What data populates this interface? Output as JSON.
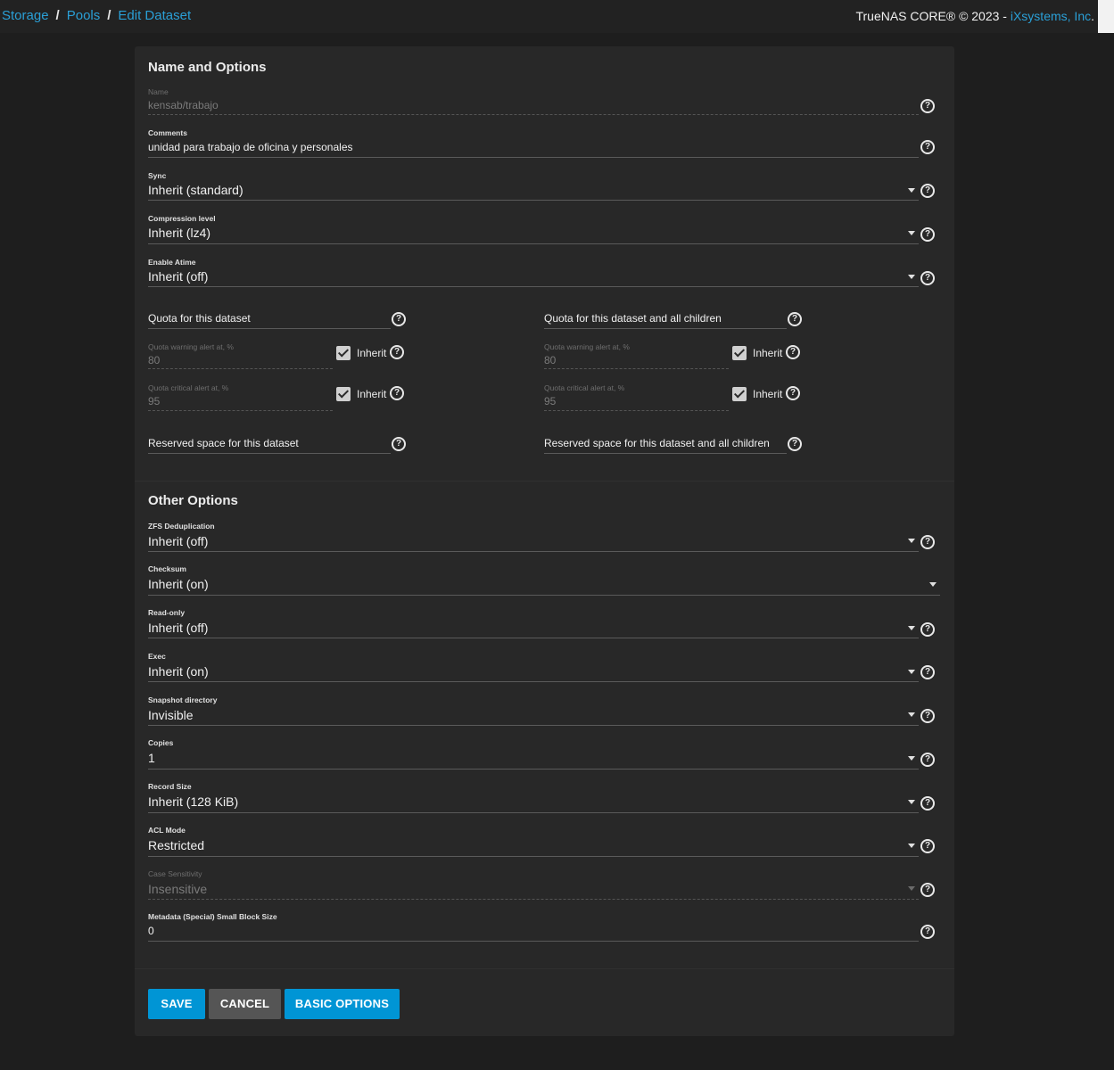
{
  "header": {
    "breadcrumb": [
      "Storage",
      "Pools",
      "Edit Dataset"
    ],
    "separator": "/",
    "copyright_prefix": "TrueNAS CORE® © 2023 - ",
    "copyright_link": "iXsystems, Inc",
    "copyright_suffix": "."
  },
  "sections": {
    "name_options": "Name and Options",
    "other_options": "Other Options"
  },
  "fields": {
    "name": {
      "label": "Name",
      "value": "kensab/trabajo"
    },
    "comments": {
      "label": "Comments",
      "value": "unidad para trabajo de oficina y personales"
    },
    "sync": {
      "label": "Sync",
      "value": "Inherit (standard)"
    },
    "compression": {
      "label": "Compression level",
      "value": "Inherit (lz4)"
    },
    "atime": {
      "label": "Enable Atime",
      "value": "Inherit (off)"
    }
  },
  "quota": {
    "dataset": {
      "label": "Quota for this dataset",
      "warning": {
        "label": "Quota warning alert at, %",
        "value": "80",
        "inherit_label": "Inherit"
      },
      "critical": {
        "label": "Quota critical alert at, %",
        "value": "95",
        "inherit_label": "Inherit"
      }
    },
    "children": {
      "label": "Quota for this dataset and all children",
      "warning": {
        "label": "Quota warning alert at, %",
        "value": "80",
        "inherit_label": "Inherit"
      },
      "critical": {
        "label": "Quota critical alert at, %",
        "value": "95",
        "inherit_label": "Inherit"
      }
    },
    "reserved_dataset": "Reserved space for this dataset",
    "reserved_children": "Reserved space for this dataset and all children"
  },
  "other": {
    "dedup": {
      "label": "ZFS Deduplication",
      "value": "Inherit (off)"
    },
    "checksum": {
      "label": "Checksum",
      "value": "Inherit (on)"
    },
    "readonly": {
      "label": "Read-only",
      "value": "Inherit (off)"
    },
    "exec": {
      "label": "Exec",
      "value": "Inherit (on)"
    },
    "snapdir": {
      "label": "Snapshot directory",
      "value": "Invisible"
    },
    "copies": {
      "label": "Copies",
      "value": "1"
    },
    "recordsize": {
      "label": "Record Size",
      "value": "Inherit (128 KiB)"
    },
    "aclmode": {
      "label": "ACL Mode",
      "value": "Restricted"
    },
    "casesens": {
      "label": "Case Sensitivity",
      "value": "Insensitive"
    },
    "smallblock": {
      "label": "Metadata (Special) Small Block Size",
      "value": "0"
    }
  },
  "buttons": {
    "save": "SAVE",
    "cancel": "CANCEL",
    "basic": "BASIC OPTIONS"
  },
  "help_glyph": "?",
  "colors": {
    "accent": "#0095d5",
    "link": "#2a9fd6",
    "background": "#1e1e1e",
    "card": "#282828"
  }
}
